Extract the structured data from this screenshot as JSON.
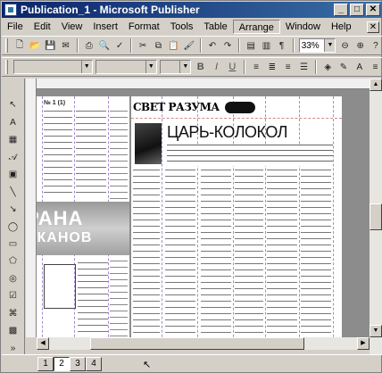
{
  "window": {
    "title": "Publication_1 - Microsoft Publisher"
  },
  "menu": [
    "File",
    "Edit",
    "View",
    "Insert",
    "Format",
    "Tools",
    "Table",
    "Arrange",
    "Window",
    "Help"
  ],
  "active_menu": "Arrange",
  "toolbar": {
    "zoom": "33%"
  },
  "document": {
    "masthead": "СВЕТ РАЗУМА",
    "headline": "ЦАРЬ-КОЛОКОЛ",
    "banner_line1": "РАНА",
    "banner_line2": "ИКАНОВ",
    "left_header": "№ 1 (1)"
  },
  "pages": [
    "1",
    "2",
    "3",
    "4"
  ],
  "current_page": "2",
  "colors": {
    "title_start": "#0a246a",
    "title_end": "#3a6ea5",
    "chrome": "#d4d0c8",
    "workspace": "#8c8c8c"
  },
  "icons": [
    "new-icon",
    "open-icon",
    "save-icon",
    "print-icon",
    "cut-icon",
    "copy-icon",
    "paste-icon",
    "undo-icon",
    "redo-icon",
    "zoom-out-icon",
    "zoom-in-icon"
  ]
}
